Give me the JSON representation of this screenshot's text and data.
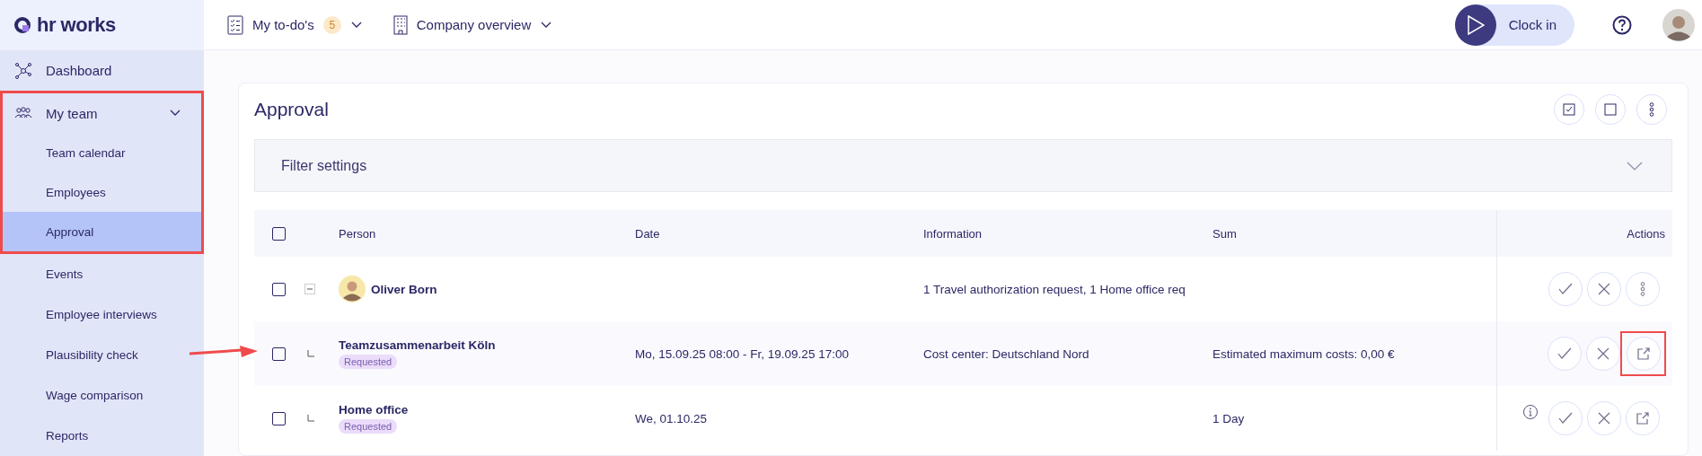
{
  "logo": {
    "text": "hr works"
  },
  "sidebar": {
    "items": [
      {
        "label": "Dashboard",
        "selected": false
      },
      {
        "label": "My team",
        "selected": false,
        "expanded": true,
        "highlighted": true,
        "children": [
          {
            "label": "Team calendar",
            "selected": false
          },
          {
            "label": "Employees",
            "selected": false
          },
          {
            "label": "Approval",
            "selected": true
          }
        ]
      },
      {
        "label": "Events",
        "selected": false
      },
      {
        "label": "Employee interviews",
        "selected": false
      },
      {
        "label": "Plausibility check",
        "selected": false
      },
      {
        "label": "Wage comparison",
        "selected": false
      },
      {
        "label": "Reports",
        "selected": false
      }
    ]
  },
  "top_bar": {
    "todos": {
      "label": "My to-do's",
      "count": "5"
    },
    "company": {
      "label": "Company overview"
    },
    "clock_in": "Clock in"
  },
  "page": {
    "title": "Approval",
    "toolbar": [
      {
        "kind": "select-all"
      },
      {
        "kind": "select-none"
      },
      {
        "kind": "more"
      }
    ],
    "filter": {
      "label": "Filter settings",
      "expanded": false
    }
  },
  "table": {
    "select_all": false,
    "columns": [
      "Person",
      "Date",
      "Information",
      "Sum",
      "Actions"
    ],
    "rows": [
      {
        "kind": "person",
        "checked": false,
        "expanded": true,
        "name": "Oliver Born",
        "information": "1 Travel authorization request, 1 Home office req",
        "actions": [
          {
            "kind": "approve"
          },
          {
            "kind": "reject"
          },
          {
            "kind": "more"
          }
        ]
      },
      {
        "kind": "request",
        "checked": false,
        "pointed": true,
        "name": "Teamzusammenarbeit Köln",
        "status": "Requested",
        "date": "Mo, 15.09.25 08:00 - Fr, 19.09.25 17:00",
        "information": "Cost center: Deutschland Nord",
        "sum": "Estimated maximum costs: 0,00 €",
        "actions": [
          {
            "kind": "approve"
          },
          {
            "kind": "reject"
          },
          {
            "kind": "open",
            "highlighted": true
          }
        ]
      },
      {
        "kind": "request",
        "checked": false,
        "info": true,
        "name": "Home office",
        "status": "Requested",
        "date": "We, 01.10.25",
        "sum": "1 Day",
        "actions": [
          {
            "kind": "approve"
          },
          {
            "kind": "reject"
          },
          {
            "kind": "open",
            "highlighted": false
          }
        ]
      }
    ]
  }
}
